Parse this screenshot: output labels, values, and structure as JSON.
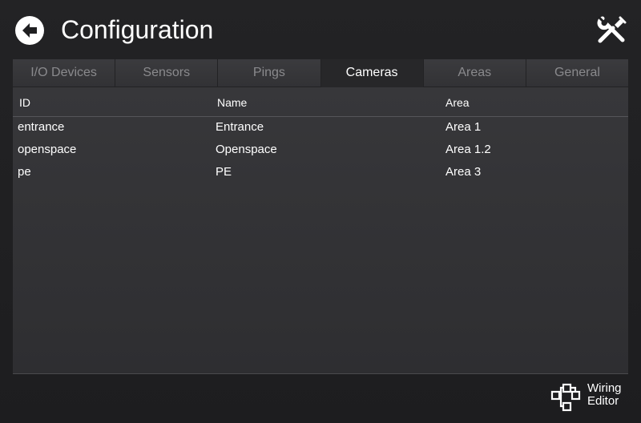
{
  "header": {
    "title": "Configuration"
  },
  "tabs": [
    {
      "label": "I/O Devices",
      "active": false
    },
    {
      "label": "Sensors",
      "active": false
    },
    {
      "label": "Pings",
      "active": false
    },
    {
      "label": "Cameras",
      "active": true
    },
    {
      "label": "Areas",
      "active": false
    },
    {
      "label": "General",
      "active": false
    }
  ],
  "table": {
    "columns": [
      "ID",
      "Name",
      "Area"
    ],
    "rows": [
      [
        "entrance",
        "Entrance",
        "Area 1"
      ],
      [
        "openspace",
        "Openspace",
        "Area 1.2"
      ],
      [
        "pe",
        "PE",
        "Area 3"
      ]
    ]
  },
  "footer": {
    "wiring_line1": "Wiring",
    "wiring_line2": "Editor"
  },
  "icons": {
    "back": "back-arrow-icon",
    "tools": "tools-icon",
    "wiring": "wiring-editor-icon"
  },
  "colors": {
    "background": "#1f1f21",
    "panel": "#343437",
    "active_tab": "#272729",
    "inactive_tab_text": "#8a8a8d",
    "text": "#ffffff"
  }
}
